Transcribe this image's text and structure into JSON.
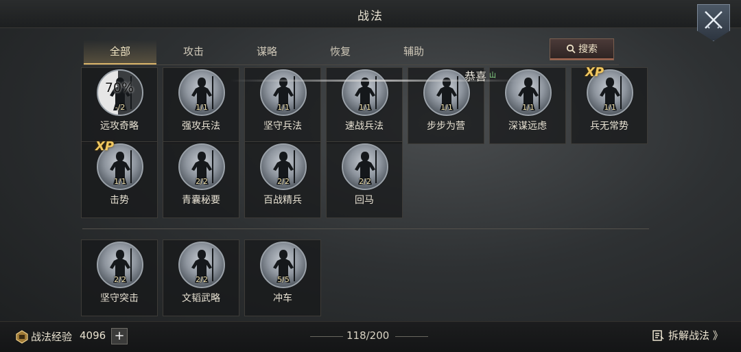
{
  "title": "战法",
  "tabs": [
    {
      "label": "全部",
      "active": true
    },
    {
      "label": "攻击"
    },
    {
      "label": "谋略"
    },
    {
      "label": "恢复"
    },
    {
      "label": "辅助"
    }
  ],
  "search_label": "搜索",
  "toast": {
    "text": "恭喜",
    "sup": "山"
  },
  "cards_learned": [
    {
      "name": "远攻奇略",
      "count": "-/2",
      "progress": "70%"
    },
    {
      "name": "强攻兵法",
      "count": "1/1"
    },
    {
      "name": "坚守兵法",
      "count": "1/1"
    },
    {
      "name": "速战兵法",
      "count": "1/1"
    },
    {
      "name": "步步为营",
      "count": "1/1"
    },
    {
      "name": "深谋远虑",
      "count": "1/1"
    },
    {
      "name": "兵无常势",
      "count": "1/1",
      "badge": "XP"
    },
    {
      "name": "击势",
      "count": "1/1",
      "badge": "XP"
    },
    {
      "name": "青囊秘要",
      "count": "2/2"
    },
    {
      "name": "百战精兵",
      "count": "2/2"
    },
    {
      "name": "回马",
      "count": "2/2"
    }
  ],
  "cards_other": [
    {
      "name": "坚守突击",
      "count": "2/2"
    },
    {
      "name": "文韬武略",
      "count": "2/2"
    },
    {
      "name": "冲车",
      "count": "5/5"
    }
  ],
  "footer": {
    "exp_label": "战法经验",
    "exp_value": "4096",
    "plus": "+",
    "capacity": "118/200",
    "decompose_label": "拆解战法 》"
  },
  "colors": {
    "accent": "#d9b46a",
    "xp": "#f0c760"
  }
}
